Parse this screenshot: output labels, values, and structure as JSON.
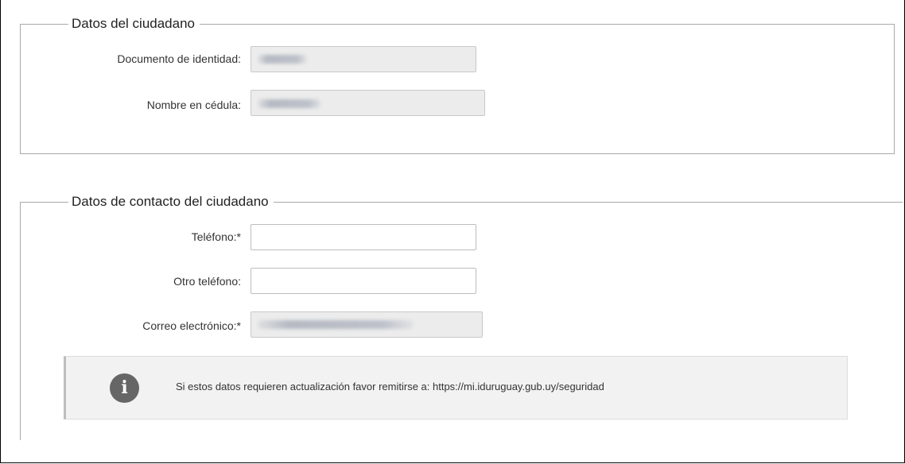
{
  "citizen": {
    "legend": "Datos del ciudadano",
    "document_label": "Documento de identidad:",
    "name_label": "Nombre en cédula:"
  },
  "contact": {
    "legend": "Datos de contacto del ciudadano",
    "phone_label": "Teléfono:*",
    "other_phone_label": "Otro teléfono:",
    "email_label": "Correo electrónico:*"
  },
  "notice": {
    "icon": "info-icon",
    "icon_glyph": "i",
    "text": "Si estos datos requieren actualización favor remitirse a: https://mi.iduruguay.gub.uy/seguridad"
  },
  "colors": {
    "readonly_bg": "#ececec",
    "info_bg": "#f2f2f2",
    "icon_bg": "#666666"
  }
}
